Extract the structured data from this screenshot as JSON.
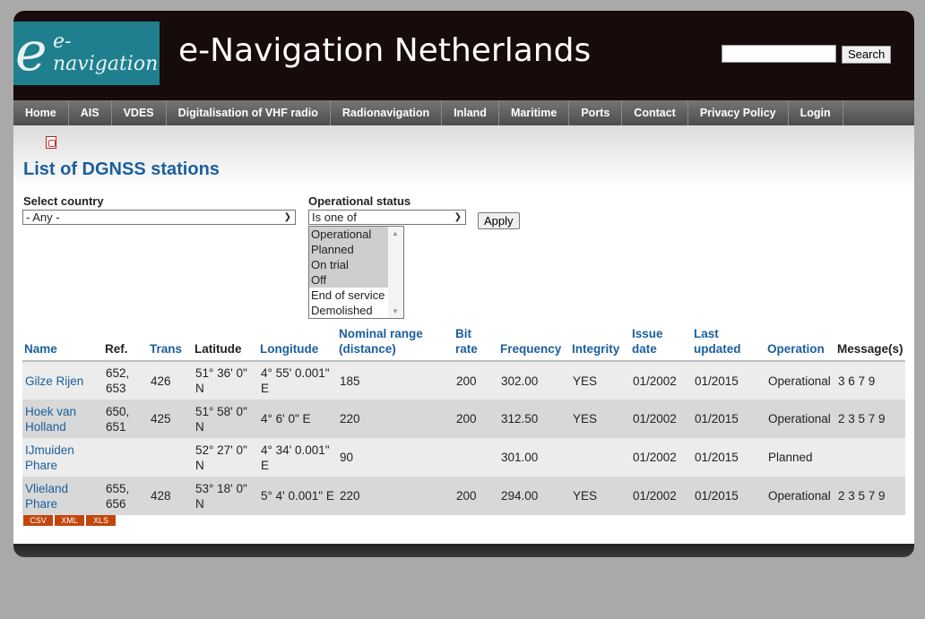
{
  "site": {
    "logo_text": "e-navigation",
    "title": "e-Navigation Netherlands",
    "search_value": "",
    "search_button": "Search"
  },
  "nav": {
    "items": [
      "Home",
      "AIS",
      "VDES",
      "Digitalisation of VHF radio",
      "Radionavigation",
      "Inland",
      "Maritime",
      "Ports",
      "Contact",
      "Privacy Policy",
      "Login"
    ]
  },
  "page": {
    "pdf_icon": "pdf-icon",
    "title": "List of DGNSS stations"
  },
  "filters": {
    "country_label": "Select country",
    "country_value": "- Any -",
    "status_label": "Operational status",
    "status_operator": "Is one of",
    "status_options": [
      {
        "label": "Operational",
        "selected": true
      },
      {
        "label": "Planned",
        "selected": true
      },
      {
        "label": "On trial",
        "selected": true
      },
      {
        "label": "Off",
        "selected": true
      },
      {
        "label": "End of service",
        "selected": false
      },
      {
        "label": "Demolished",
        "selected": false
      }
    ],
    "apply_label": "Apply"
  },
  "table": {
    "headers": [
      "Name",
      "Ref.",
      "Trans",
      "Latitude",
      "Longitude",
      "Nominal range (distance)",
      "Bit rate",
      "Frequency",
      "Integrity",
      "Issue date",
      "Last updated",
      "Operation",
      "Message(s)"
    ],
    "rows": [
      [
        "Gilze Rijen",
        "652, 653",
        "426",
        "51° 36' 0\" N",
        "4° 55' 0.001\" E",
        "185",
        "200",
        "302.00",
        "YES",
        "01/2002",
        "01/2015",
        "Operational",
        "3 6 7 9"
      ],
      [
        "Hoek van Holland",
        "650, 651",
        "425",
        "51° 58' 0\" N",
        "4° 6' 0\" E",
        "220",
        "200",
        "312.50",
        "YES",
        "01/2002",
        "01/2015",
        "Operational",
        "2 3 5 7 9"
      ],
      [
        "IJmuiden Phare",
        "",
        "",
        "52° 27' 0\" N",
        "4° 34' 0.001\" E",
        "90",
        "",
        "301.00",
        "",
        "01/2002",
        "01/2015",
        "Planned",
        ""
      ],
      [
        "Vlieland Phare",
        "655, 656",
        "428",
        "53° 18' 0\" N",
        "5° 4' 0.001\" E",
        "220",
        "200",
        "294.00",
        "YES",
        "01/2002",
        "01/2015",
        "Operational",
        "2 3 5 7 9"
      ]
    ]
  },
  "exports": [
    "CSV",
    "XML",
    "XLS"
  ]
}
